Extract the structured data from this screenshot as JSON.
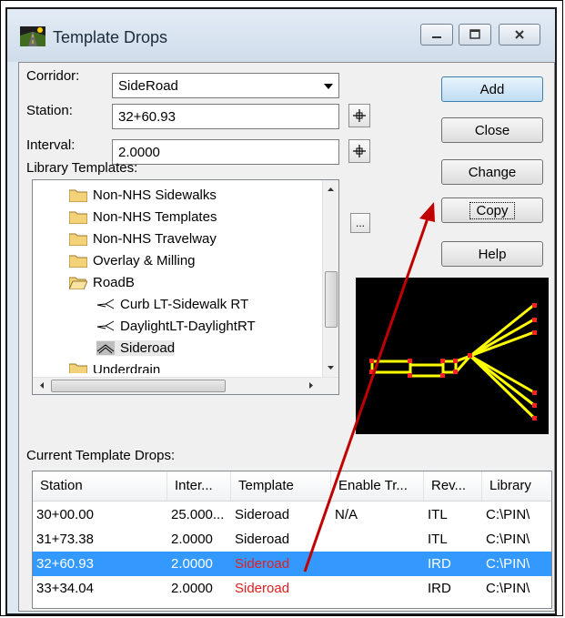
{
  "window": {
    "title": "Template Drops"
  },
  "form": {
    "corridor_label": "Corridor:",
    "corridor_value": "SideRoad",
    "station_label": "Station:",
    "station_value": "32+60.93",
    "interval_label": "Interval:",
    "interval_value": "2.0000"
  },
  "buttons": {
    "add": "Add",
    "close": "Close",
    "change": "Change",
    "copy": "Copy",
    "help": "Help",
    "browse": "..."
  },
  "library": {
    "label": "Library Templates:",
    "items": [
      {
        "label": "Non-NHS Sidewalks",
        "icon": "folder-icon"
      },
      {
        "label": "Non-NHS Templates",
        "icon": "folder-icon"
      },
      {
        "label": "Non-NHS Travelway",
        "icon": "folder-icon"
      },
      {
        "label": "Overlay & Milling",
        "icon": "folder-icon"
      },
      {
        "label": "RoadB",
        "icon": "folder-open-icon"
      },
      {
        "label": "Curb LT-Sidewalk RT",
        "icon": "template-icon"
      },
      {
        "label": "DaylightLT-DaylightRT",
        "icon": "template-icon"
      },
      {
        "label": "Sideroad",
        "icon": "template-selected-icon"
      },
      {
        "label": "Underdrain",
        "icon": "folder-icon"
      }
    ]
  },
  "drops": {
    "label": "Current Template Drops:",
    "columns": [
      "Station",
      "Inter...",
      "Template",
      "Enable Tr...",
      "Rev...",
      "Library"
    ],
    "rows": [
      {
        "station": "30+00.00",
        "interval": "25.000...",
        "template": "Sideroad",
        "enable": "N/A",
        "rev": "ITL",
        "library": "C:\\PIN\\"
      },
      {
        "station": "31+73.38",
        "interval": "2.0000",
        "template": "Sideroad",
        "enable": "",
        "rev": "ITL",
        "library": "C:\\PIN\\"
      },
      {
        "station": "32+60.93",
        "interval": "2.0000",
        "template": "Sideroad",
        "enable": "",
        "rev": "IRD",
        "library": "C:\\PIN\\"
      },
      {
        "station": "33+34.04",
        "interval": "2.0000",
        "template": "Sideroad",
        "enable": "",
        "rev": "IRD",
        "library": "C:\\PIN\\"
      }
    ]
  },
  "colors": {
    "selection": "#3399ff",
    "template_red": "#e0201e",
    "annotation_arrow": "#c00000",
    "preview_lines": "#ffff00"
  }
}
